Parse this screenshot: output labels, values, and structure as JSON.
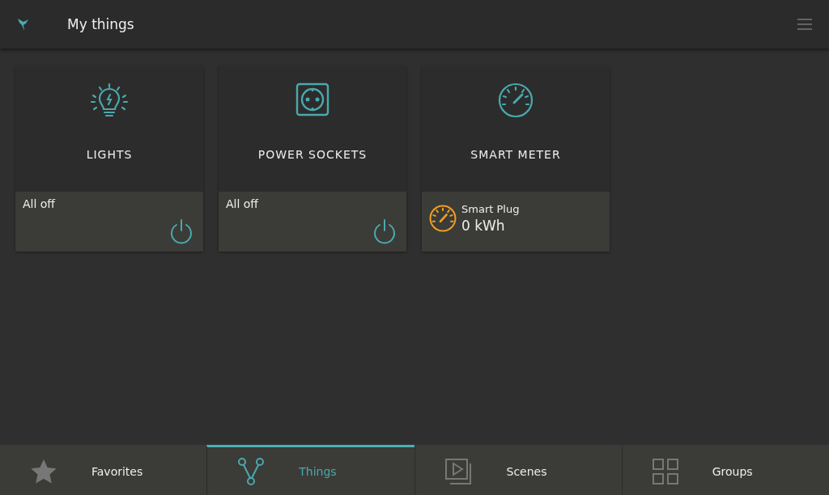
{
  "header": {
    "title": "My things"
  },
  "cards": [
    {
      "kind": "light",
      "title": "LIGHTS",
      "status": "All off"
    },
    {
      "kind": "socket",
      "title": "POWER SOCKETS",
      "status": "All off"
    },
    {
      "kind": "meter",
      "title": "SMART METER",
      "device": "Smart Plug",
      "reading": "0 kWh"
    }
  ],
  "tabs": [
    {
      "label": "Favorites",
      "selected": false
    },
    {
      "label": "Things",
      "selected": true
    },
    {
      "label": "Scenes",
      "selected": false
    },
    {
      "label": "Groups",
      "selected": false
    }
  ]
}
